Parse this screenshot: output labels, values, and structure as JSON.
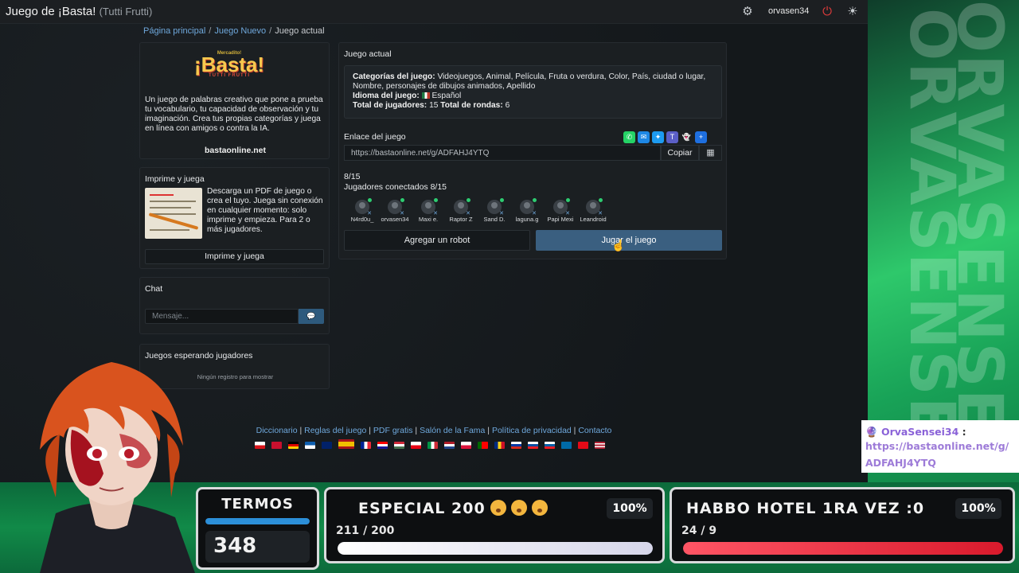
{
  "topbar": {
    "title": "Juego de ¡Basta!",
    "subtitle": "(Tutti Frutti)",
    "username": "orvasen34"
  },
  "breadcrumb": {
    "home": "Página principal",
    "new_game": "Juego Nuevo",
    "current": "Juego actual"
  },
  "intro": {
    "logo_top": "Mercadito!",
    "logo_main": "¡Basta!",
    "logo_tag": "TUTTI FRUTTI",
    "text": "Un juego de palabras creativo que pone a prueba tu vocabulario, tu capacidad de observación y tu imaginación. Crea tus propias categorías y juega en línea con amigos o contra la IA.",
    "site": "bastaonline.net"
  },
  "print": {
    "title": "Imprime y juega",
    "text": "Descarga un PDF de juego o crea el tuyo. Juega sin conexión en cualquier momento: solo imprime y empieza. Para 2 o más jugadores.",
    "button": "Imprime y juega"
  },
  "chat": {
    "title": "Chat",
    "placeholder": "Mensaje..."
  },
  "waiting": {
    "title": "Juegos esperando jugadores",
    "empty": "Ningún registro para mostrar"
  },
  "game": {
    "title": "Juego actual",
    "categories_label": "Categorías del juego:",
    "categories": "Videojuegos, Animal, Película, Fruta o verdura, Color, País, ciudad o lugar, Nombre, personajes de dibujos animados, Apellido",
    "language_label": "Idioma del juego:",
    "language": "Español",
    "players_label": "Total de jugadores:",
    "players_total": "15",
    "rounds_label": "Total de rondas:",
    "rounds_total": "6",
    "link_label": "Enlace del juego",
    "link": "https://bastaonline.net/g/ADFAHJ4YTQ",
    "copy": "Copiar",
    "count": "8/15",
    "connected": "Jugadores conectados 8/15",
    "players": [
      "N4rd0u_",
      "orvasen34",
      "Maxi e.",
      "Raptor Z",
      "Sand D.",
      "laguna.g",
      "Papi Mexi",
      "Leandroid"
    ],
    "add_robot": "Agregar un robot",
    "play": "Jugar el juego"
  },
  "footer": {
    "links": [
      "Diccionario",
      "Reglas del juego",
      "PDF gratis",
      "Salón de la Fama",
      "Política de privacidad",
      "Contacto"
    ]
  },
  "overlay": {
    "watermark": "ORVASENSEI",
    "chat_user": "OrvaSensei34",
    "chat_colon": ":",
    "chat_message": "https://bastaonline.net/g/ADFAHJ4YTQ"
  },
  "stream": {
    "termos_title": "TERMOS",
    "termos_value": "348",
    "goal1_title": "ESPECIAL 200",
    "goal1_progress": "211 / 200",
    "goal1_pct": "100%",
    "goal1_fill": 1.0,
    "goal2_title": "HABBO HOTEL 1RA VEZ :0",
    "goal2_progress": "24 / 9",
    "goal2_pct": "100%",
    "goal2_fill": 1.0
  },
  "colors": {
    "accent_blue": "#3a5f80",
    "link_blue": "#6fa8dc",
    "green_bg": "#118a48",
    "goal2_red": "#e2283a"
  }
}
